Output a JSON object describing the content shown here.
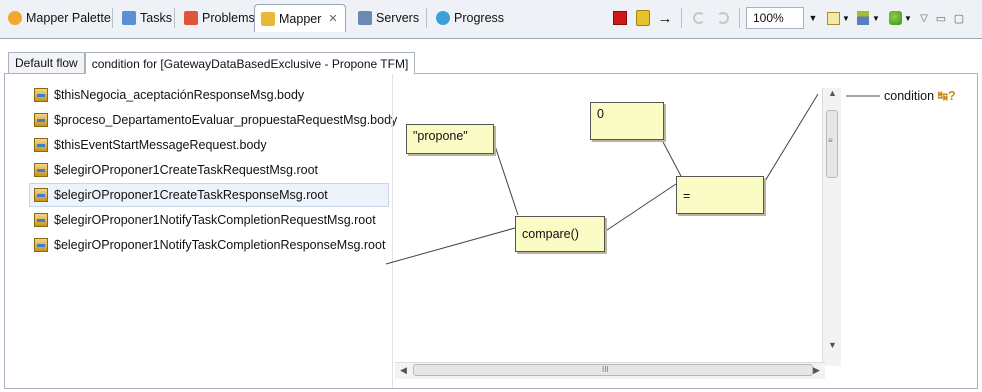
{
  "tabs": [
    {
      "label": "Mapper Palette",
      "icon": "palette-icon"
    },
    {
      "label": "Tasks",
      "icon": "tasks-icon"
    },
    {
      "label": "Problems",
      "icon": "problems-icon"
    },
    {
      "label": "Mapper",
      "icon": "mapper-icon",
      "active": true,
      "close": "✕"
    },
    {
      "label": "Servers",
      "icon": "servers-icon"
    },
    {
      "label": "Progress",
      "icon": "progress-icon"
    }
  ],
  "toolbar": {
    "zoom": "100%",
    "arrow_glyph": "→",
    "minimize_glyph": "▽",
    "restore_glyph": "▭",
    "maximize_glyph": "▢"
  },
  "subtabs": [
    {
      "label": "Default flow",
      "active": false
    },
    {
      "label": "condition for [GatewayDataBasedExclusive - Propone TFM]",
      "active": true
    }
  ],
  "variables": [
    "$thisNegocia_aceptaciónResponseMsg.body",
    "$proceso_DepartamentoEvaluar_propuestaRequestMsg.body",
    "$thisEventStartMessageRequest.body",
    "$elegirOProponer1CreateTaskRequestMsg.root",
    "$elegirOProponer1CreateTaskResponseMsg.root",
    "$elegirOProponer1NotifyTaskCompletionRequestMsg.root",
    "$elegirOProponer1NotifyTaskCompletionResponseMsg.root"
  ],
  "selected_variable_index": 4,
  "nodes": {
    "propone": "\"propone\"",
    "zero": "0",
    "equals": "=",
    "compare": "compare()"
  },
  "output": {
    "label": "condition",
    "glyph": "↹?"
  },
  "scroll": {
    "up": "▲",
    "down": "▼",
    "left": "◀",
    "right": "▶",
    "grip_v": "≡",
    "grip_h": "III"
  },
  "colors": {
    "tab_bar": "#eef1f6",
    "node_fill": "#fbfbc6",
    "stop_red": "#d01818",
    "selection": "#eef3fb"
  }
}
